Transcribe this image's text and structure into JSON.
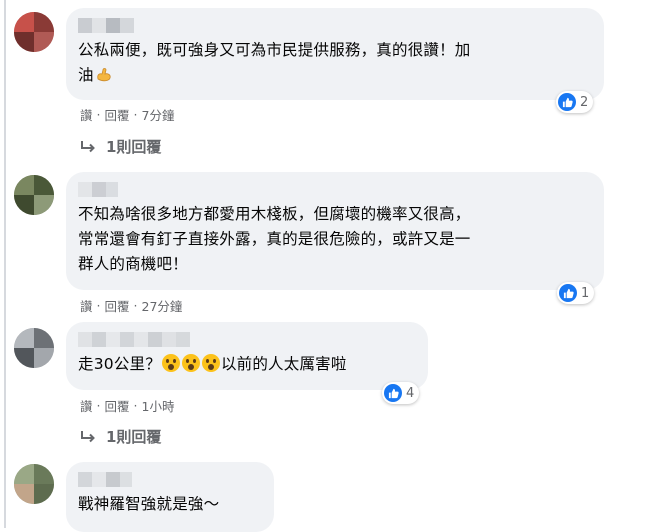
{
  "comments": [
    {
      "text": "公私兩便，既可強身又可為市民提供服務，真的很讚！加\n油",
      "reaction_count": "2",
      "actions": {
        "like": "讚",
        "reply": "回覆",
        "time": "7分鐘"
      },
      "replies_label": "1則回覆"
    },
    {
      "text": "不知為啥很多地方都愛用木棧板，但腐壞的機率又很高，\n常常還會有釘子直接外露，真的是很危險的，或許又是一\n群人的商機吧！",
      "reaction_count": "1",
      "actions": {
        "like": "讚",
        "reply": "回覆",
        "time": "27分鐘"
      }
    },
    {
      "text_before": "走30公里？",
      "text_after": "以前的人太厲害啦",
      "reaction_count": "4",
      "actions": {
        "like": "讚",
        "reply": "回覆",
        "time": "1小時"
      },
      "replies_label": "1則回覆"
    },
    {
      "text": "戰神羅智強就是強～"
    }
  ],
  "separator": "·",
  "colors": {
    "bubble": "#f0f2f5",
    "like_blue": "#1877f2",
    "meta_gray": "#65676b",
    "text": "#050505"
  },
  "icons": {
    "like": "thumbs-up-icon",
    "reply_arrow": "reply-arrow-icon",
    "flex": "flexed-biceps-emoji",
    "surprised": "surprised-face-emoji"
  }
}
